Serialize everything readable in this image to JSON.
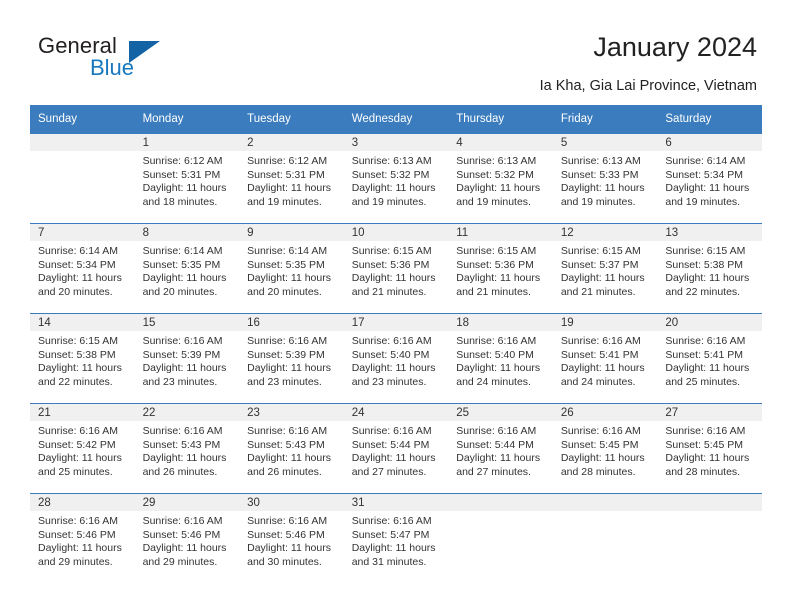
{
  "brand": {
    "name_top": "General",
    "name_bottom": "Blue",
    "triangle_color": "#1464a5",
    "blue_color": "#1878be"
  },
  "header": {
    "title": "January 2024",
    "subtitle": "Ia Kha, Gia Lai Province, Vietnam"
  },
  "theme": {
    "header_blue": "#3a7cbe",
    "daynum_band": "#f0f0f0",
    "text": "#333333"
  },
  "weekday_headers": [
    "Sunday",
    "Monday",
    "Tuesday",
    "Wednesday",
    "Thursday",
    "Friday",
    "Saturday"
  ],
  "weeks": [
    [
      {
        "day": "",
        "sunrise": "",
        "sunset": "",
        "daylight": ""
      },
      {
        "day": "1",
        "sunrise": "Sunrise: 6:12 AM",
        "sunset": "Sunset: 5:31 PM",
        "daylight": "Daylight: 11 hours and 18 minutes."
      },
      {
        "day": "2",
        "sunrise": "Sunrise: 6:12 AM",
        "sunset": "Sunset: 5:31 PM",
        "daylight": "Daylight: 11 hours and 19 minutes."
      },
      {
        "day": "3",
        "sunrise": "Sunrise: 6:13 AM",
        "sunset": "Sunset: 5:32 PM",
        "daylight": "Daylight: 11 hours and 19 minutes."
      },
      {
        "day": "4",
        "sunrise": "Sunrise: 6:13 AM",
        "sunset": "Sunset: 5:32 PM",
        "daylight": "Daylight: 11 hours and 19 minutes."
      },
      {
        "day": "5",
        "sunrise": "Sunrise: 6:13 AM",
        "sunset": "Sunset: 5:33 PM",
        "daylight": "Daylight: 11 hours and 19 minutes."
      },
      {
        "day": "6",
        "sunrise": "Sunrise: 6:14 AM",
        "sunset": "Sunset: 5:34 PM",
        "daylight": "Daylight: 11 hours and 19 minutes."
      }
    ],
    [
      {
        "day": "7",
        "sunrise": "Sunrise: 6:14 AM",
        "sunset": "Sunset: 5:34 PM",
        "daylight": "Daylight: 11 hours and 20 minutes."
      },
      {
        "day": "8",
        "sunrise": "Sunrise: 6:14 AM",
        "sunset": "Sunset: 5:35 PM",
        "daylight": "Daylight: 11 hours and 20 minutes."
      },
      {
        "day": "9",
        "sunrise": "Sunrise: 6:14 AM",
        "sunset": "Sunset: 5:35 PM",
        "daylight": "Daylight: 11 hours and 20 minutes."
      },
      {
        "day": "10",
        "sunrise": "Sunrise: 6:15 AM",
        "sunset": "Sunset: 5:36 PM",
        "daylight": "Daylight: 11 hours and 21 minutes."
      },
      {
        "day": "11",
        "sunrise": "Sunrise: 6:15 AM",
        "sunset": "Sunset: 5:36 PM",
        "daylight": "Daylight: 11 hours and 21 minutes."
      },
      {
        "day": "12",
        "sunrise": "Sunrise: 6:15 AM",
        "sunset": "Sunset: 5:37 PM",
        "daylight": "Daylight: 11 hours and 21 minutes."
      },
      {
        "day": "13",
        "sunrise": "Sunrise: 6:15 AM",
        "sunset": "Sunset: 5:38 PM",
        "daylight": "Daylight: 11 hours and 22 minutes."
      }
    ],
    [
      {
        "day": "14",
        "sunrise": "Sunrise: 6:15 AM",
        "sunset": "Sunset: 5:38 PM",
        "daylight": "Daylight: 11 hours and 22 minutes."
      },
      {
        "day": "15",
        "sunrise": "Sunrise: 6:16 AM",
        "sunset": "Sunset: 5:39 PM",
        "daylight": "Daylight: 11 hours and 23 minutes."
      },
      {
        "day": "16",
        "sunrise": "Sunrise: 6:16 AM",
        "sunset": "Sunset: 5:39 PM",
        "daylight": "Daylight: 11 hours and 23 minutes."
      },
      {
        "day": "17",
        "sunrise": "Sunrise: 6:16 AM",
        "sunset": "Sunset: 5:40 PM",
        "daylight": "Daylight: 11 hours and 23 minutes."
      },
      {
        "day": "18",
        "sunrise": "Sunrise: 6:16 AM",
        "sunset": "Sunset: 5:40 PM",
        "daylight": "Daylight: 11 hours and 24 minutes."
      },
      {
        "day": "19",
        "sunrise": "Sunrise: 6:16 AM",
        "sunset": "Sunset: 5:41 PM",
        "daylight": "Daylight: 11 hours and 24 minutes."
      },
      {
        "day": "20",
        "sunrise": "Sunrise: 6:16 AM",
        "sunset": "Sunset: 5:41 PM",
        "daylight": "Daylight: 11 hours and 25 minutes."
      }
    ],
    [
      {
        "day": "21",
        "sunrise": "Sunrise: 6:16 AM",
        "sunset": "Sunset: 5:42 PM",
        "daylight": "Daylight: 11 hours and 25 minutes."
      },
      {
        "day": "22",
        "sunrise": "Sunrise: 6:16 AM",
        "sunset": "Sunset: 5:43 PM",
        "daylight": "Daylight: 11 hours and 26 minutes."
      },
      {
        "day": "23",
        "sunrise": "Sunrise: 6:16 AM",
        "sunset": "Sunset: 5:43 PM",
        "daylight": "Daylight: 11 hours and 26 minutes."
      },
      {
        "day": "24",
        "sunrise": "Sunrise: 6:16 AM",
        "sunset": "Sunset: 5:44 PM",
        "daylight": "Daylight: 11 hours and 27 minutes."
      },
      {
        "day": "25",
        "sunrise": "Sunrise: 6:16 AM",
        "sunset": "Sunset: 5:44 PM",
        "daylight": "Daylight: 11 hours and 27 minutes."
      },
      {
        "day": "26",
        "sunrise": "Sunrise: 6:16 AM",
        "sunset": "Sunset: 5:45 PM",
        "daylight": "Daylight: 11 hours and 28 minutes."
      },
      {
        "day": "27",
        "sunrise": "Sunrise: 6:16 AM",
        "sunset": "Sunset: 5:45 PM",
        "daylight": "Daylight: 11 hours and 28 minutes."
      }
    ],
    [
      {
        "day": "28",
        "sunrise": "Sunrise: 6:16 AM",
        "sunset": "Sunset: 5:46 PM",
        "daylight": "Daylight: 11 hours and 29 minutes."
      },
      {
        "day": "29",
        "sunrise": "Sunrise: 6:16 AM",
        "sunset": "Sunset: 5:46 PM",
        "daylight": "Daylight: 11 hours and 29 minutes."
      },
      {
        "day": "30",
        "sunrise": "Sunrise: 6:16 AM",
        "sunset": "Sunset: 5:46 PM",
        "daylight": "Daylight: 11 hours and 30 minutes."
      },
      {
        "day": "31",
        "sunrise": "Sunrise: 6:16 AM",
        "sunset": "Sunset: 5:47 PM",
        "daylight": "Daylight: 11 hours and 31 minutes."
      },
      {
        "day": "",
        "sunrise": "",
        "sunset": "",
        "daylight": ""
      },
      {
        "day": "",
        "sunrise": "",
        "sunset": "",
        "daylight": ""
      },
      {
        "day": "",
        "sunrise": "",
        "sunset": "",
        "daylight": ""
      }
    ]
  ]
}
